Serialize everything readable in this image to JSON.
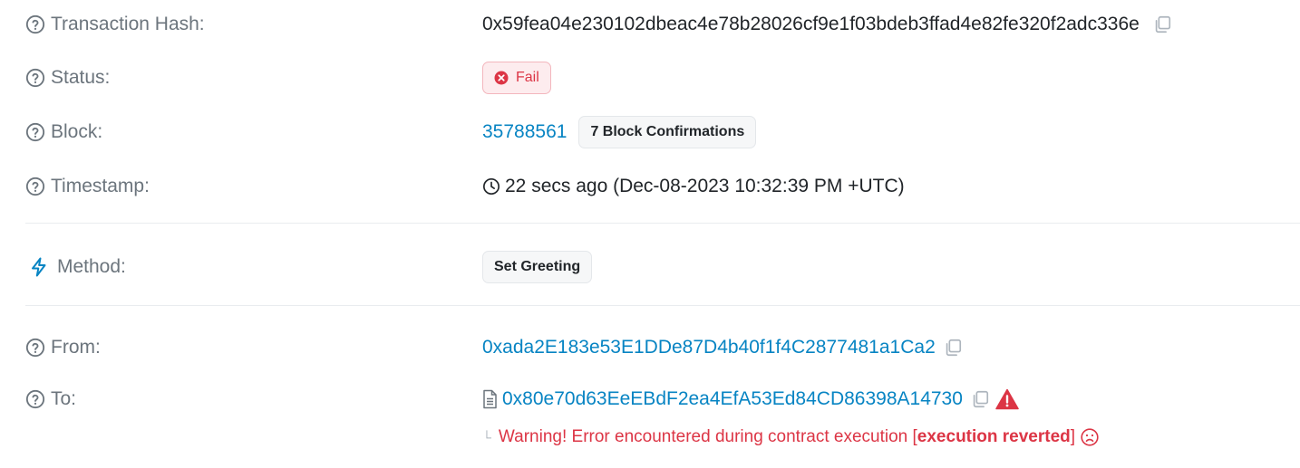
{
  "tx": {
    "hash_label": "Transaction Hash:",
    "hash_value": "0x59fea04e230102dbeac4e78b28026cf9e1f03bdeb3ffad4e82fe320f2adc336e",
    "status_label": "Status:",
    "status_value": "Fail",
    "block_label": "Block:",
    "block_value": "35788561",
    "block_confirmations": "7 Block Confirmations",
    "timestamp_label": "Timestamp:",
    "timestamp_value": "22 secs ago (Dec-08-2023 10:32:39 PM +UTC)",
    "method_label": "Method:",
    "method_value": "Set Greeting",
    "from_label": "From:",
    "from_value": "0xada2E183e53E1DDe87D4b40f1f4C2877481a1Ca2",
    "to_label": "To:",
    "to_value": "0x80e70d63EeEBdF2ea4EfA53Ed84CD86398A14730",
    "warning_prefix": "Warning! Error encountered during contract execution [",
    "warning_bold": "execution reverted",
    "warning_suffix": "]"
  },
  "colors": {
    "link": "#0784c3",
    "fail": "#dc3545",
    "muted": "#6c757d"
  },
  "icons": {
    "help": "question-circle-icon",
    "method": "lightning-icon",
    "clock": "clock-icon",
    "copy": "copy-icon",
    "contract": "document-icon",
    "warning": "warning-triangle-icon",
    "sad": "sad-face-icon"
  }
}
